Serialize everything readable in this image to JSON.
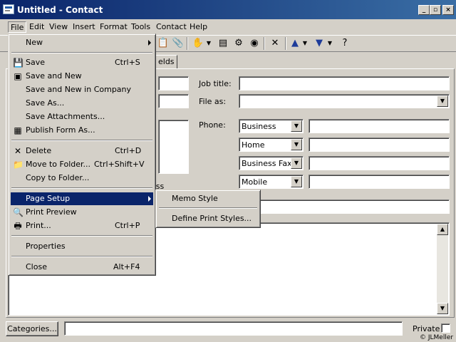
{
  "window": {
    "title": "Untitled - Contact"
  },
  "menubar": [
    "File",
    "Edit",
    "View",
    "Insert",
    "Format",
    "Tools",
    "Contact",
    "Help"
  ],
  "tab_partial": "elds",
  "form": {
    "job_title_label": "Job title:",
    "file_as_label": "File as:",
    "phone_label": "Phone:",
    "phone_types": [
      "Business",
      "Home",
      "Business Fax",
      "Mobile"
    ],
    "partial_label": "ess"
  },
  "footer": {
    "categories_button": "Categories...",
    "private_label": "Private",
    "copyright": "© JLMeller"
  },
  "file_menu": {
    "items": [
      {
        "label": "New",
        "shortcut": "",
        "submenu": true
      },
      {
        "label": "Save",
        "shortcut": "Ctrl+S",
        "icon": "save-icon"
      },
      {
        "label": "Save and New",
        "shortcut": "",
        "icon": "save-new-icon"
      },
      {
        "label": "Save and New in Company",
        "shortcut": ""
      },
      {
        "label": "Save As...",
        "shortcut": ""
      },
      {
        "label": "Save Attachments...",
        "shortcut": ""
      },
      {
        "label": "Publish Form As...",
        "shortcut": "",
        "icon": "publish-form-icon"
      },
      {
        "label": "Delete",
        "shortcut": "Ctrl+D",
        "icon": "delete-icon"
      },
      {
        "label": "Move to Folder...",
        "shortcut": "Ctrl+Shift+V",
        "icon": "move-folder-icon"
      },
      {
        "label": "Copy to Folder...",
        "shortcut": ""
      },
      {
        "label": "Page Setup",
        "shortcut": "",
        "submenu": true,
        "highlighted": true
      },
      {
        "label": "Print Preview",
        "shortcut": "",
        "icon": "print-preview-icon"
      },
      {
        "label": "Print...",
        "shortcut": "Ctrl+P",
        "icon": "printer-icon"
      },
      {
        "label": "Properties",
        "shortcut": ""
      },
      {
        "label": "Close",
        "shortcut": "Alt+F4"
      }
    ]
  },
  "page_setup_submenu": {
    "items": [
      "Memo Style",
      "Define Print Styles..."
    ]
  },
  "colors": {
    "title_start": "#0a246a",
    "title_end": "#3a6ea5",
    "face": "#d4d0c8",
    "highlight": "#0a246a"
  }
}
